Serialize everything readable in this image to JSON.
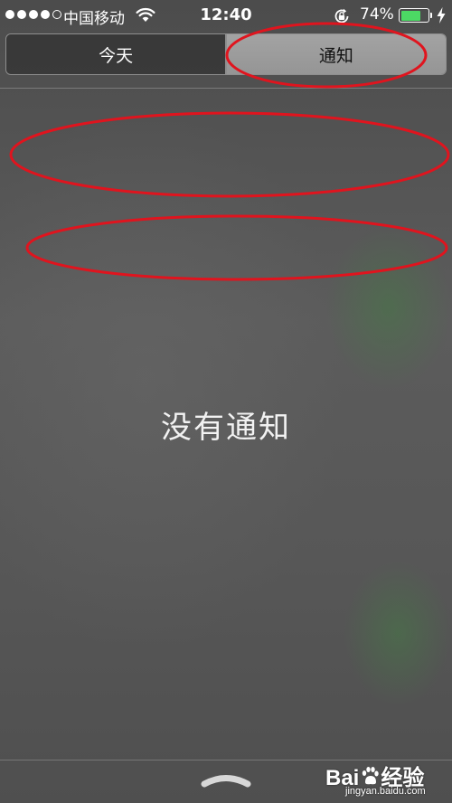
{
  "status_bar": {
    "signal_filled": 4,
    "carrier": "中国移动",
    "time": "12:40",
    "battery_percent": "74%",
    "battery_level": 0.74,
    "icons": [
      "signal-dots-icon",
      "wifi-icon",
      "rotation-lock-icon",
      "battery-icon",
      "charging-bolt-icon"
    ]
  },
  "segmented_control": {
    "tabs": [
      {
        "label": "今天",
        "selected": false
      },
      {
        "label": "通知",
        "selected": true
      }
    ]
  },
  "main": {
    "empty_message": "没有通知"
  },
  "bottom": {
    "grabber_icon": "chevron-up-icon"
  },
  "watermark": {
    "brand": "Bai",
    "brand_suffix": "经验",
    "site": "jingyan.baidu.com"
  },
  "colors": {
    "background": "#5a5a5a",
    "battery_fill": "#4cd964",
    "annotation_red": "#e0141e",
    "selected_tab": "#a3a3a3"
  }
}
